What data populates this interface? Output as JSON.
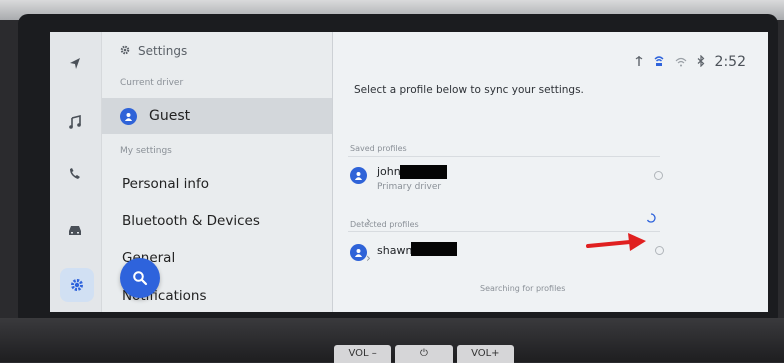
{
  "header": {
    "title": "Settings",
    "time": "2:52"
  },
  "status_icons": [
    "phone-signal-icon",
    "connected-service-icon",
    "wifi-icon",
    "bluetooth-icon"
  ],
  "left_menu": {
    "current_driver_label": "Current driver",
    "current_driver": "Guest",
    "my_settings_label": "My settings",
    "items": [
      {
        "label": "Personal info",
        "has_chevron": false
      },
      {
        "label": "Bluetooth & Devices",
        "has_chevron": true
      },
      {
        "label": "General",
        "has_chevron": true
      },
      {
        "label": "Notifications",
        "has_chevron": false
      }
    ]
  },
  "rail": {
    "icons": [
      "navigation-icon",
      "music-icon",
      "phone-icon",
      "car-icon",
      "settings-gear-icon"
    ],
    "active": "settings-gear-icon"
  },
  "main": {
    "prompt": "Select a profile below to sync your settings.",
    "saved_profiles_label": "Saved profiles",
    "saved_profiles": [
      {
        "name": "john",
        "subtitle": "Primary driver",
        "name_redacted": true
      }
    ],
    "detected_profiles_label": "Detected profiles",
    "detected_profiles": [
      {
        "name": "shawn",
        "name_redacted": true
      }
    ],
    "searching_text": "Searching for profiles"
  },
  "hardware_buttons": {
    "vol_down": "VOL –",
    "power": "⏻",
    "vol_up": "VOL+"
  },
  "colors": {
    "accent": "#2e63dc",
    "annotation_arrow": "#e02020"
  }
}
